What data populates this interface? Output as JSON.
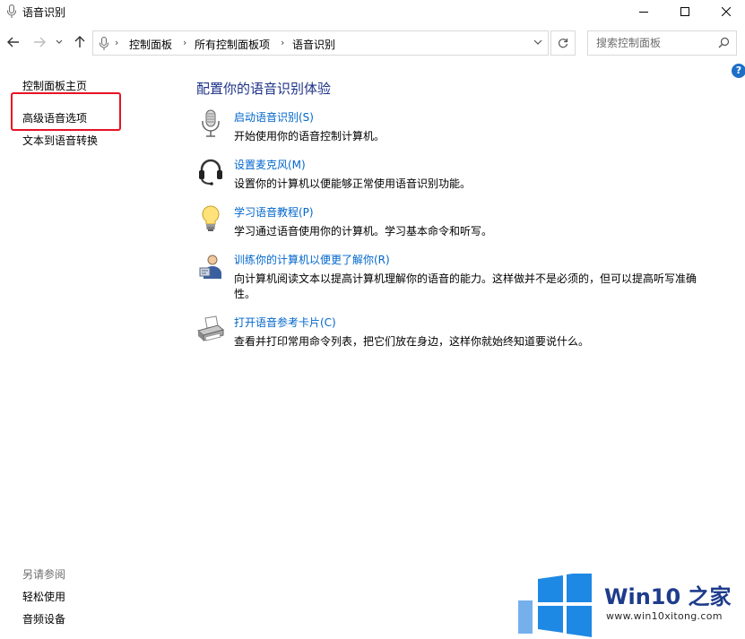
{
  "window": {
    "title": "语音识别",
    "controls": {
      "minimize": "minimize-icon",
      "maximize": "maximize-icon",
      "close": "close-icon"
    }
  },
  "nav": {
    "breadcrumbs": [
      "控制面板",
      "所有控制面板项",
      "语音识别"
    ],
    "search_placeholder": "搜索控制面板"
  },
  "sidebar": {
    "home": "控制面板主页",
    "items": [
      "高级语音选项",
      "文本到语音转换"
    ],
    "see_also_heading": "另请参阅",
    "see_also": [
      "轻松使用",
      "音频设备"
    ]
  },
  "main": {
    "heading": "配置你的语音识别体验",
    "tasks": [
      {
        "label": "启动语音识别(S)",
        "description": "开始使用你的语音控制计算机。",
        "icon": "microphone-icon"
      },
      {
        "label": "设置麦克风(M)",
        "description": "设置你的计算机以便能够正常使用语音识别功能。",
        "icon": "headset-icon"
      },
      {
        "label": "学习语音教程(P)",
        "description": "学习通过语音使用你的计算机。学习基本命令和听写。",
        "icon": "lightbulb-icon"
      },
      {
        "label": "训练你的计算机以便更了解你(R)",
        "description": "向计算机阅读文本以提高计算机理解你的语音的能力。这样做并不是必须的，但可以提高听写准确性。",
        "icon": "user-training-icon"
      },
      {
        "label": "打开语音参考卡片(C)",
        "description": "查看并打印常用命令列表，把它们放在身边，这样你就始终知道要说什么。",
        "icon": "printer-icon"
      }
    ]
  },
  "watermark": {
    "brand": "Win10 之家",
    "url": "www.win10xitong.com"
  },
  "colors": {
    "link": "#0066cc",
    "heading": "#1e3287",
    "highlight": "#e81123",
    "windows_blue": "#1e88e5"
  }
}
